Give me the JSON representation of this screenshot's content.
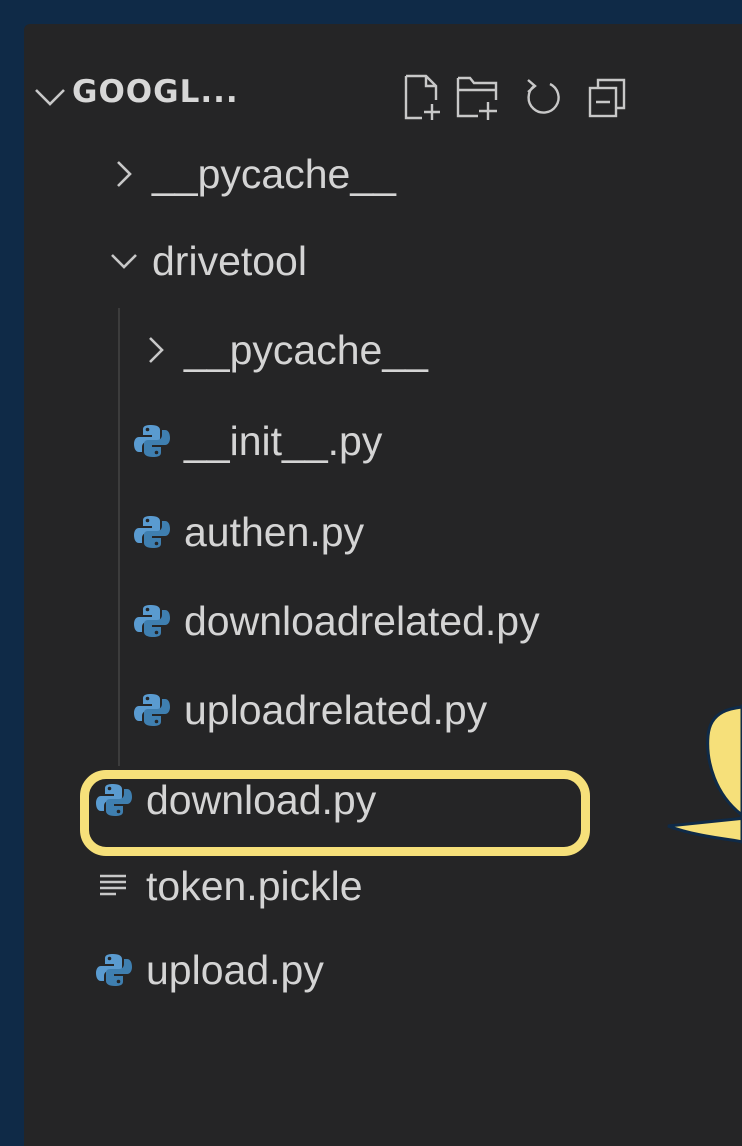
{
  "explorer": {
    "title": "GOOGL...",
    "toolbar": [
      {
        "icon": "new-file-icon"
      },
      {
        "icon": "new-folder-icon"
      },
      {
        "icon": "refresh-icon"
      },
      {
        "icon": "collapse-all-icon"
      }
    ]
  },
  "tree": {
    "items": [
      {
        "label": "__pycache__",
        "type": "folder",
        "expanded": false
      },
      {
        "label": "drivetool",
        "type": "folder",
        "expanded": true
      },
      {
        "label": "__pycache__",
        "type": "folder",
        "expanded": false
      },
      {
        "label": "__init__.py",
        "type": "python-file"
      },
      {
        "label": "authen.py",
        "type": "python-file"
      },
      {
        "label": "downloadrelated.py",
        "type": "python-file"
      },
      {
        "label": "uploadrelated.py",
        "type": "python-file"
      },
      {
        "label": "download.py",
        "type": "python-file"
      },
      {
        "label": "token.pickle",
        "type": "text-file",
        "highlighted": true
      },
      {
        "label": "upload.py",
        "type": "python-file"
      }
    ]
  },
  "colors": {
    "background": "#0f2a47",
    "panel": "#252526",
    "text": "#d4d4d4",
    "highlight": "#f6e07a",
    "python_icon": "#4f8fbf"
  }
}
